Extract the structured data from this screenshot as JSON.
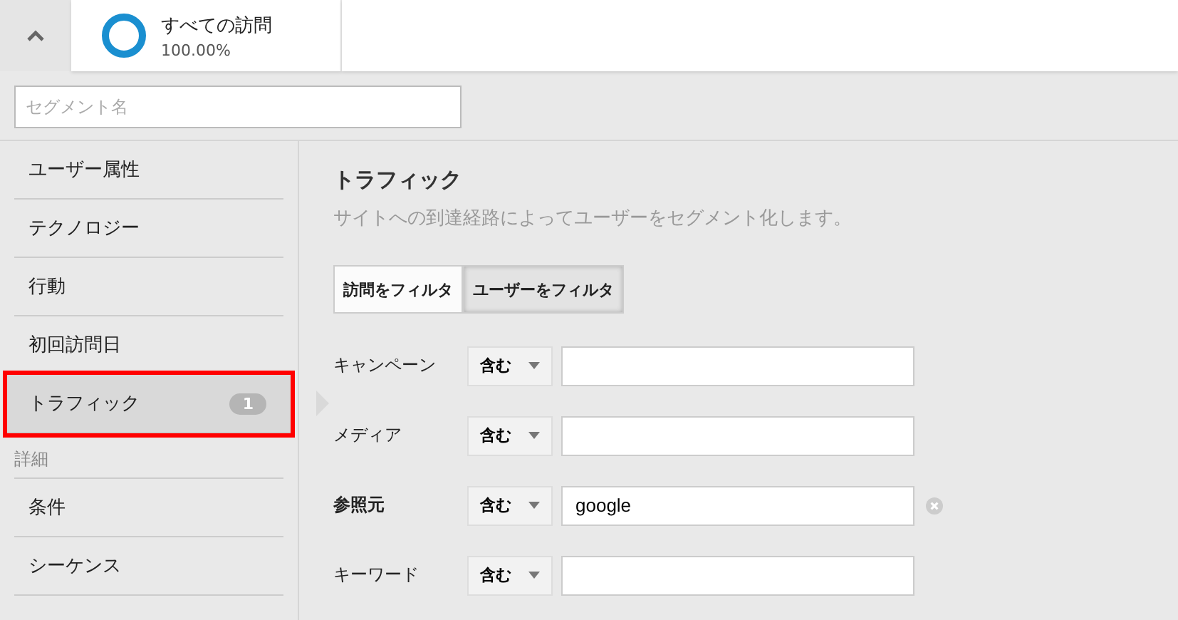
{
  "segment": {
    "title": "すべての訪問",
    "percent": "100.00%"
  },
  "search": {
    "placeholder": "セグメント名"
  },
  "sidebar": {
    "items": [
      {
        "label": "ユーザー属性",
        "selected": false
      },
      {
        "label": "テクノロジー",
        "selected": false
      },
      {
        "label": "行動",
        "selected": false
      },
      {
        "label": "初回訪問日",
        "selected": false
      },
      {
        "label": "トラフィック",
        "selected": true,
        "badge": "1",
        "highlighted": true
      }
    ],
    "section": "詳細",
    "advanced": [
      {
        "label": "条件",
        "selected": false
      },
      {
        "label": "シーケンス",
        "selected": false
      }
    ]
  },
  "main": {
    "title": "トラフィック",
    "description": "サイトへの到達経路によってユーザーをセグメント化します。",
    "tabs": [
      {
        "label": "訪問をフィルタ",
        "selected": false
      },
      {
        "label": "ユーザーをフィルタ",
        "selected": true
      }
    ],
    "fields": [
      {
        "label": "キャンペーン",
        "operator": "含む"
      },
      {
        "label": "メディア",
        "operator": "含む"
      },
      {
        "label": "参照元",
        "operator": "含む",
        "value": "google"
      },
      {
        "label": "キーワード",
        "operator": "含む"
      }
    ]
  }
}
